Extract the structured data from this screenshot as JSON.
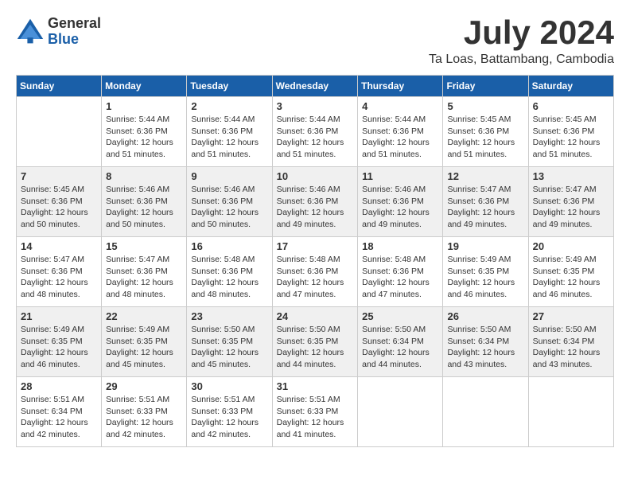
{
  "logo": {
    "general": "General",
    "blue": "Blue"
  },
  "title": {
    "month": "July 2024",
    "location": "Ta Loas, Battambang, Cambodia"
  },
  "weekdays": [
    "Sunday",
    "Monday",
    "Tuesday",
    "Wednesday",
    "Thursday",
    "Friday",
    "Saturday"
  ],
  "weeks": [
    [
      {
        "day": "",
        "info": ""
      },
      {
        "day": "1",
        "info": "Sunrise: 5:44 AM\nSunset: 6:36 PM\nDaylight: 12 hours\nand 51 minutes."
      },
      {
        "day": "2",
        "info": "Sunrise: 5:44 AM\nSunset: 6:36 PM\nDaylight: 12 hours\nand 51 minutes."
      },
      {
        "day": "3",
        "info": "Sunrise: 5:44 AM\nSunset: 6:36 PM\nDaylight: 12 hours\nand 51 minutes."
      },
      {
        "day": "4",
        "info": "Sunrise: 5:44 AM\nSunset: 6:36 PM\nDaylight: 12 hours\nand 51 minutes."
      },
      {
        "day": "5",
        "info": "Sunrise: 5:45 AM\nSunset: 6:36 PM\nDaylight: 12 hours\nand 51 minutes."
      },
      {
        "day": "6",
        "info": "Sunrise: 5:45 AM\nSunset: 6:36 PM\nDaylight: 12 hours\nand 51 minutes."
      }
    ],
    [
      {
        "day": "7",
        "info": "Sunrise: 5:45 AM\nSunset: 6:36 PM\nDaylight: 12 hours\nand 50 minutes."
      },
      {
        "day": "8",
        "info": "Sunrise: 5:46 AM\nSunset: 6:36 PM\nDaylight: 12 hours\nand 50 minutes."
      },
      {
        "day": "9",
        "info": "Sunrise: 5:46 AM\nSunset: 6:36 PM\nDaylight: 12 hours\nand 50 minutes."
      },
      {
        "day": "10",
        "info": "Sunrise: 5:46 AM\nSunset: 6:36 PM\nDaylight: 12 hours\nand 49 minutes."
      },
      {
        "day": "11",
        "info": "Sunrise: 5:46 AM\nSunset: 6:36 PM\nDaylight: 12 hours\nand 49 minutes."
      },
      {
        "day": "12",
        "info": "Sunrise: 5:47 AM\nSunset: 6:36 PM\nDaylight: 12 hours\nand 49 minutes."
      },
      {
        "day": "13",
        "info": "Sunrise: 5:47 AM\nSunset: 6:36 PM\nDaylight: 12 hours\nand 49 minutes."
      }
    ],
    [
      {
        "day": "14",
        "info": "Sunrise: 5:47 AM\nSunset: 6:36 PM\nDaylight: 12 hours\nand 48 minutes."
      },
      {
        "day": "15",
        "info": "Sunrise: 5:47 AM\nSunset: 6:36 PM\nDaylight: 12 hours\nand 48 minutes."
      },
      {
        "day": "16",
        "info": "Sunrise: 5:48 AM\nSunset: 6:36 PM\nDaylight: 12 hours\nand 48 minutes."
      },
      {
        "day": "17",
        "info": "Sunrise: 5:48 AM\nSunset: 6:36 PM\nDaylight: 12 hours\nand 47 minutes."
      },
      {
        "day": "18",
        "info": "Sunrise: 5:48 AM\nSunset: 6:36 PM\nDaylight: 12 hours\nand 47 minutes."
      },
      {
        "day": "19",
        "info": "Sunrise: 5:49 AM\nSunset: 6:35 PM\nDaylight: 12 hours\nand 46 minutes."
      },
      {
        "day": "20",
        "info": "Sunrise: 5:49 AM\nSunset: 6:35 PM\nDaylight: 12 hours\nand 46 minutes."
      }
    ],
    [
      {
        "day": "21",
        "info": "Sunrise: 5:49 AM\nSunset: 6:35 PM\nDaylight: 12 hours\nand 46 minutes."
      },
      {
        "day": "22",
        "info": "Sunrise: 5:49 AM\nSunset: 6:35 PM\nDaylight: 12 hours\nand 45 minutes."
      },
      {
        "day": "23",
        "info": "Sunrise: 5:50 AM\nSunset: 6:35 PM\nDaylight: 12 hours\nand 45 minutes."
      },
      {
        "day": "24",
        "info": "Sunrise: 5:50 AM\nSunset: 6:35 PM\nDaylight: 12 hours\nand 44 minutes."
      },
      {
        "day": "25",
        "info": "Sunrise: 5:50 AM\nSunset: 6:34 PM\nDaylight: 12 hours\nand 44 minutes."
      },
      {
        "day": "26",
        "info": "Sunrise: 5:50 AM\nSunset: 6:34 PM\nDaylight: 12 hours\nand 43 minutes."
      },
      {
        "day": "27",
        "info": "Sunrise: 5:50 AM\nSunset: 6:34 PM\nDaylight: 12 hours\nand 43 minutes."
      }
    ],
    [
      {
        "day": "28",
        "info": "Sunrise: 5:51 AM\nSunset: 6:34 PM\nDaylight: 12 hours\nand 42 minutes."
      },
      {
        "day": "29",
        "info": "Sunrise: 5:51 AM\nSunset: 6:33 PM\nDaylight: 12 hours\nand 42 minutes."
      },
      {
        "day": "30",
        "info": "Sunrise: 5:51 AM\nSunset: 6:33 PM\nDaylight: 12 hours\nand 42 minutes."
      },
      {
        "day": "31",
        "info": "Sunrise: 5:51 AM\nSunset: 6:33 PM\nDaylight: 12 hours\nand 41 minutes."
      },
      {
        "day": "",
        "info": ""
      },
      {
        "day": "",
        "info": ""
      },
      {
        "day": "",
        "info": ""
      }
    ]
  ]
}
